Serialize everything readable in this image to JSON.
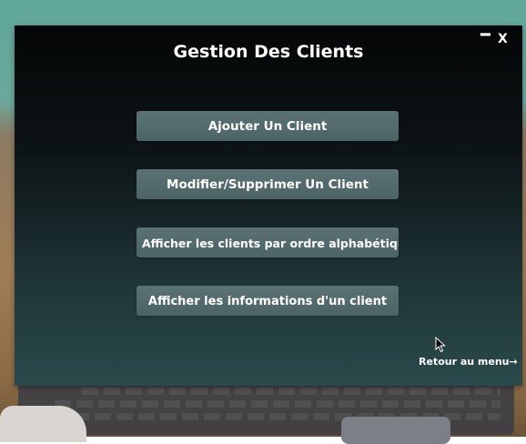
{
  "window": {
    "title": "Gestion Des Clients",
    "minimize_label": "━",
    "close_label": "X"
  },
  "menu": {
    "buttons": [
      {
        "label": "Ajouter Un Client"
      },
      {
        "label": "Modifier/Supprimer Un Client"
      },
      {
        "label": "Afficher les clients par ordre alphabétique"
      },
      {
        "label": "Afficher les informations d'un client"
      }
    ]
  },
  "footer": {
    "back_label": "Retour au menu→"
  },
  "colors": {
    "window_bg_top": "#050607",
    "window_bg_bottom": "#2a4a4b",
    "button_bg": "#566e70",
    "text": "#ffffff"
  },
  "icons": {
    "cursor": "mouse-pointer-icon"
  }
}
